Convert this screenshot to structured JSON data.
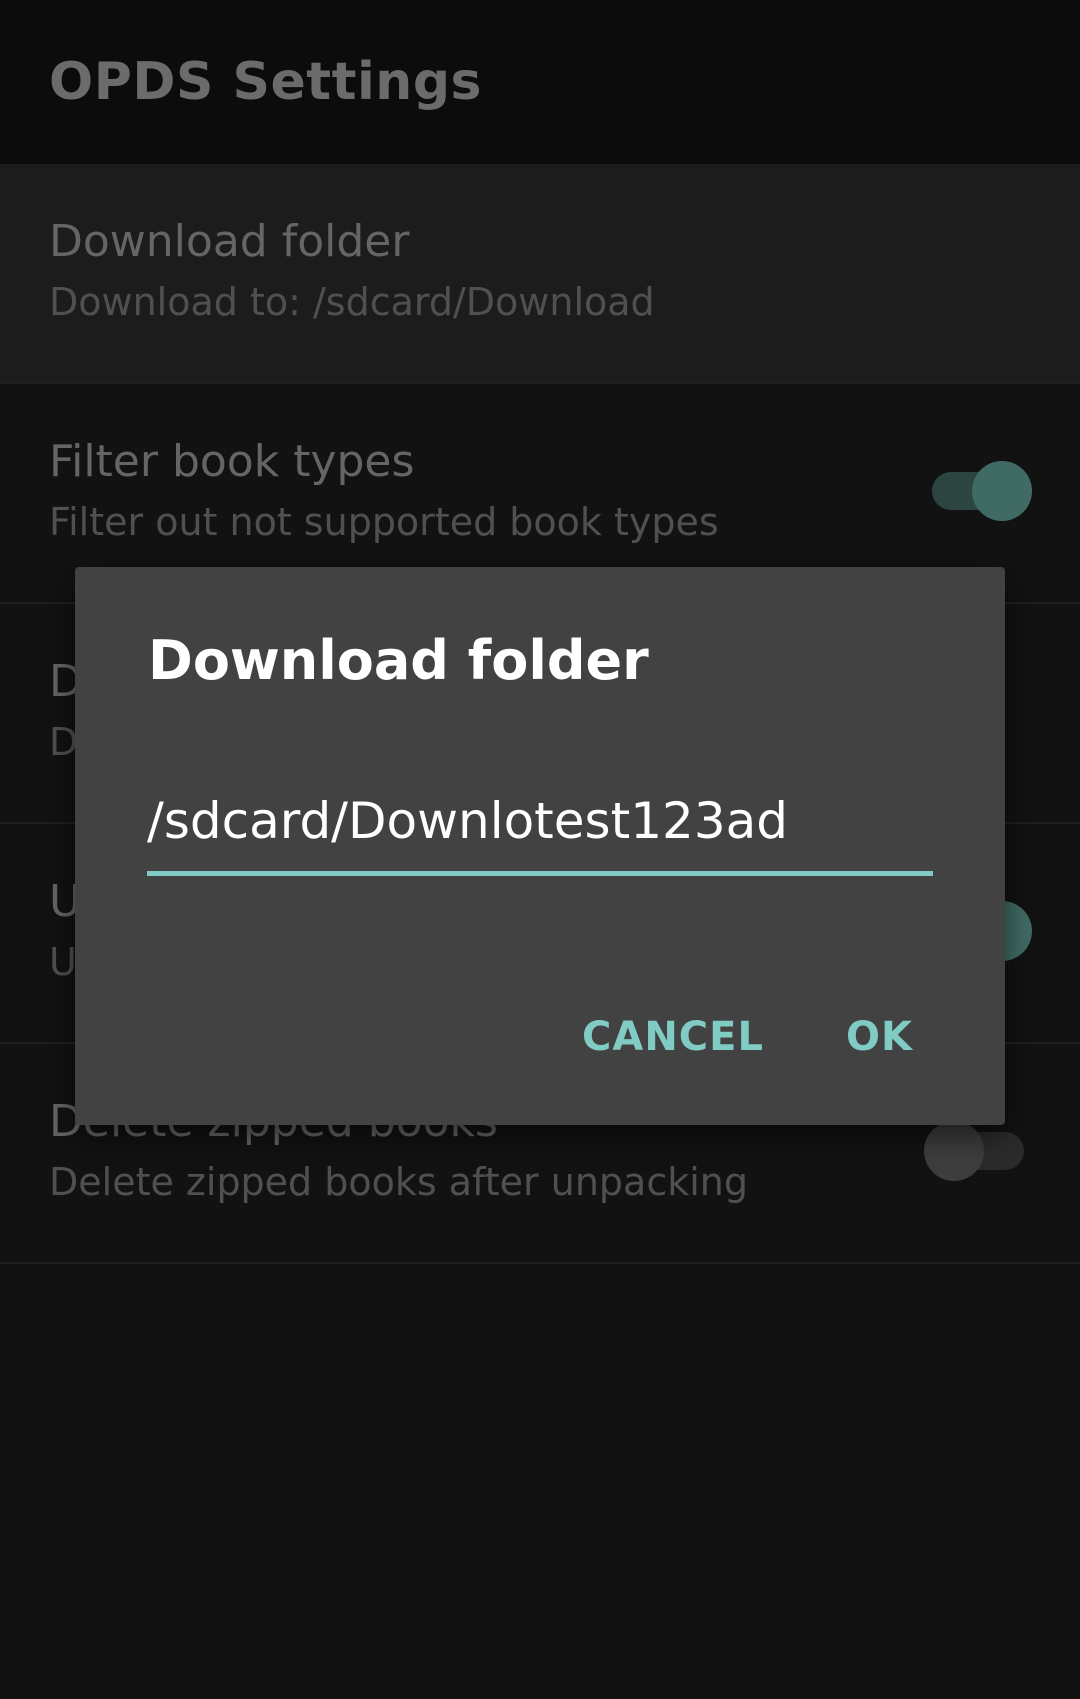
{
  "appbar": {
    "title": "OPDS Settings"
  },
  "settings": [
    {
      "title": "Download folder",
      "summary": "Download to: /sdcard/Download"
    },
    {
      "title": "Filter book types",
      "summary": "Filter out not supported book types",
      "switch": "on"
    },
    {
      "title": "D",
      "summary": "D"
    },
    {
      "title": "U",
      "summary": "U",
      "switch": "on"
    },
    {
      "title": "Delete zipped books",
      "summary": "Delete zipped books after unpacking",
      "switch": "off"
    }
  ],
  "dialog": {
    "title": "Download folder",
    "input_value": "/sdcard/Downlotest123ad",
    "cancel_label": "CANCEL",
    "ok_label": "OK"
  },
  "colors": {
    "accent": "#80cbc4",
    "dialog_bg": "#424242",
    "screen_bg": "#121212"
  }
}
